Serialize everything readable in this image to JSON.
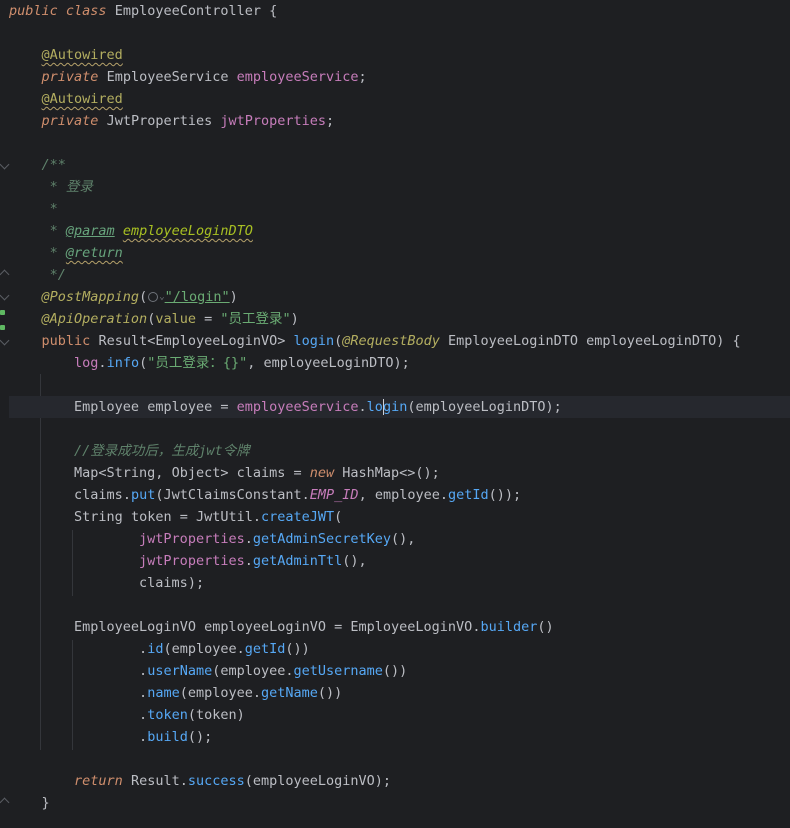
{
  "editor": {
    "class_line": {
      "kw_public": "public",
      "kw_class": "class",
      "class_name": "EmployeeController",
      "brace": " {"
    },
    "field1": {
      "annotation": "@Autowired",
      "kw": "private",
      "type": "EmployeeService",
      "name": "employeeService",
      "end": ";"
    },
    "field2": {
      "annotation": "@Autowired",
      "kw": "private",
      "type": "JwtProperties",
      "name": "jwtProperties",
      "end": ";"
    },
    "javadoc": {
      "open": "/**",
      "line_title": " * 登录",
      "line_blank": " *",
      "param_prefix": " * ",
      "param_tag": "@param",
      "param_name": "employeeLoginDTO",
      "return_prefix": " * ",
      "return_tag": "@return",
      "close": " */"
    },
    "post_mapping": {
      "annotation": "@PostMapping",
      "open": "(",
      "path": "\"/login\"",
      "close": ")"
    },
    "api_operation": {
      "annotation": "@ApiOperation",
      "open": "(",
      "param": "value",
      "eq": " = ",
      "value": "\"员工登录\"",
      "close": ")"
    },
    "method_sig": {
      "kw": "public",
      "type": "Result<EmployeeLoginVO>",
      "name": "login",
      "open": "(",
      "param_ann": "@RequestBody",
      "param_type": "EmployeeLoginDTO",
      "param_name": "employeeLoginDTO",
      "close": ") {"
    },
    "log_line": {
      "obj": "log",
      "dot": ".",
      "method": "info",
      "open": "(",
      "str": "\"员工登录：{}\"",
      "rest": ", employeeLoginDTO);"
    },
    "employee_line": {
      "type": "Employee",
      "var": " employee = ",
      "field": "employeeService",
      "dot": ".",
      "method_a": "lo",
      "method_b": "gin",
      "rest": "(employeeLoginDTO);"
    },
    "comment_line": "//登录成功后，生成jwt令牌",
    "claims_decl": {
      "type": "Map<String, Object>",
      "var": " claims = ",
      "kw": "new",
      "ctor": " HashMap<>();"
    },
    "claims_put": {
      "obj": "claims",
      "dot": ".",
      "method": "put",
      "open": "(JwtClaimsConstant.",
      "const": "EMP_ID",
      "mid": ", employee.",
      "method2": "getId",
      "close": "());"
    },
    "token_line": {
      "type": "String",
      "var": " token = JwtUtil.",
      "method": "createJWT",
      "open": "("
    },
    "token_arg1": {
      "field": "jwtProperties",
      "dot": ".",
      "method": "getAdminSecretKey",
      "close": "(),"
    },
    "token_arg2": {
      "field": "jwtProperties",
      "dot": ".",
      "method": "getAdminTtl",
      "close": "(),"
    },
    "token_arg3": "claims);",
    "vo_line": {
      "type": "EmployeeLoginVO",
      "var": " employeeLoginVO = ",
      "cls": "EmployeeLoginVO",
      "dot": ".",
      "method": "builder",
      "close": "()"
    },
    "builder_id": {
      "dot": ".",
      "method": "id",
      "open": "(employee.",
      "method2": "getId",
      "close": "())"
    },
    "builder_username": {
      "dot": ".",
      "method": "userName",
      "open": "(employee.",
      "method2": "getUsername",
      "close": "())"
    },
    "builder_name": {
      "dot": ".",
      "method": "name",
      "open": "(employee.",
      "method2": "getName",
      "close": "())"
    },
    "builder_token": {
      "dot": ".",
      "method": "token",
      "args": "(token)"
    },
    "builder_build": {
      "dot": ".",
      "method": "build",
      "args": "();"
    },
    "return_line": {
      "kw": "return",
      "cls": " Result.",
      "method": "success",
      "args": "(employeeLoginVO);"
    },
    "close_brace": "}"
  },
  "colors": {
    "background": "#1e1f22",
    "keyword": "#cf8e6d",
    "annotation": "#b3ae60",
    "field": "#c77dbb",
    "method": "#56a8f5",
    "string": "#6aab73",
    "comment": "#5f826b",
    "plain": "#bcbec4"
  },
  "icons": {
    "bulb": "lightbulb-icon",
    "fold": "fold-marker-icon",
    "url": "web-globe-icon"
  }
}
